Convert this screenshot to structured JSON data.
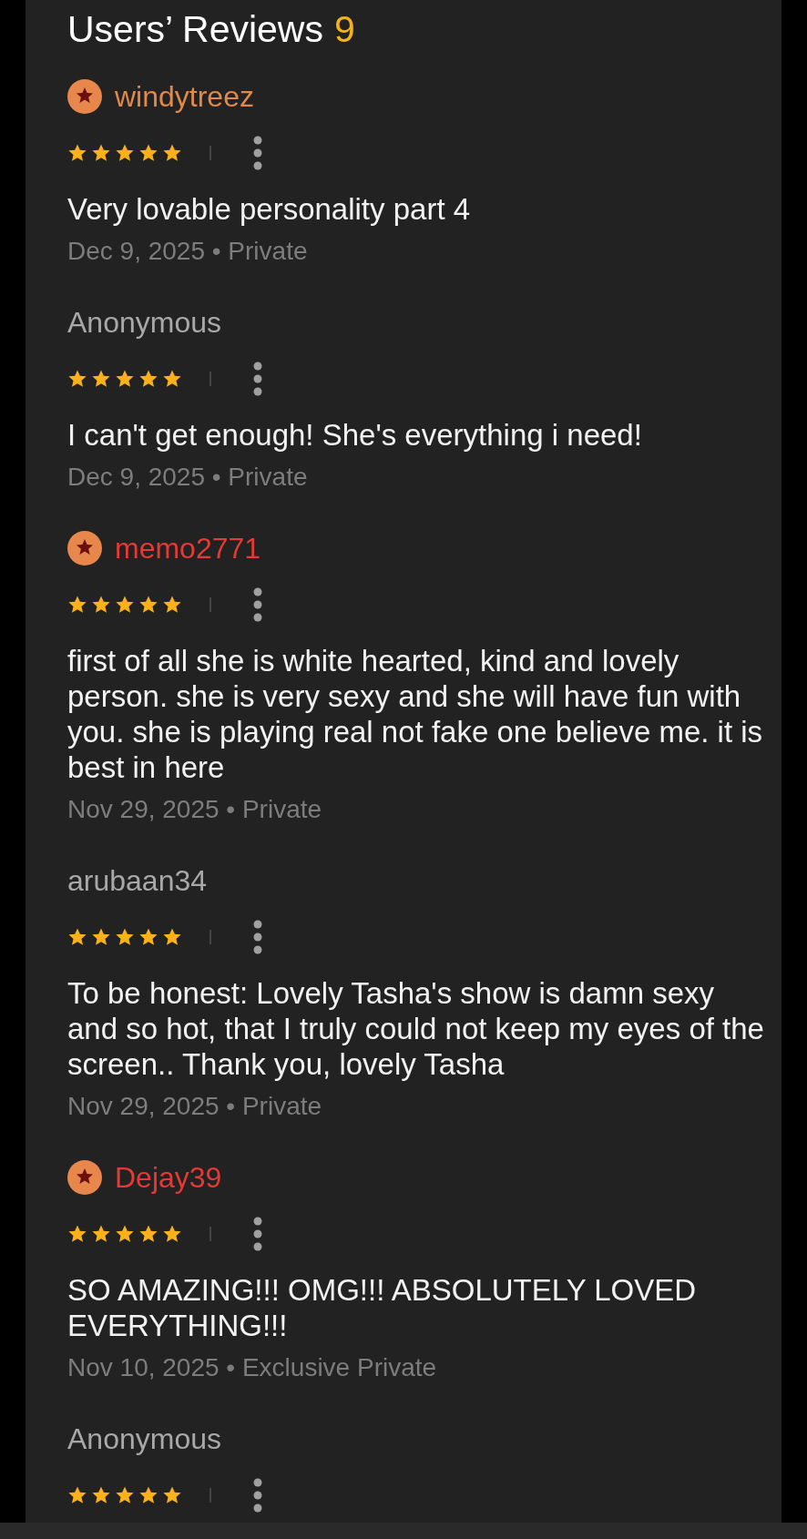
{
  "title": {
    "label": "Users’ Reviews",
    "count": "9"
  },
  "reviews": [
    {
      "name": "windytreez",
      "color": "#e0894a",
      "badge": true,
      "stars": 5,
      "text": "Very lovable personality part 4",
      "meta": "Dec 9, 2025 • Private"
    },
    {
      "name": "Anonymous",
      "color": "#a8a8a8",
      "badge": false,
      "stars": 5,
      "text": "I can't get enough! She's everything i need!",
      "meta": "Dec 9, 2025 • Private"
    },
    {
      "name": "memo2771",
      "color": "#e53935",
      "badge": true,
      "stars": 5,
      "text": "first of all she is white hearted, kind and lovely person. she is very sexy and she will have fun with you. she is playing real not fake one believe me. it is best in here",
      "meta": "Nov 29, 2025 • Private"
    },
    {
      "name": "arubaan34",
      "color": "#a8a8a8",
      "badge": false,
      "stars": 5,
      "text": "To be honest: Lovely Tasha's show is damn sexy and so hot, that I truly could not keep my eyes of the screen.. Thank you, lovely Tasha",
      "meta": "Nov 29, 2025 • Private"
    },
    {
      "name": "Dejay39",
      "color": "#e53935",
      "badge": true,
      "stars": 5,
      "text": "SO AMAZING!!! OMG!!! ABSOLUTELY LOVED EVERYTHING!!!",
      "meta": "Nov 10, 2025 • Exclusive Private"
    },
    {
      "name": "Anonymous",
      "color": "#a8a8a8",
      "badge": false,
      "stars": 5
    }
  ]
}
